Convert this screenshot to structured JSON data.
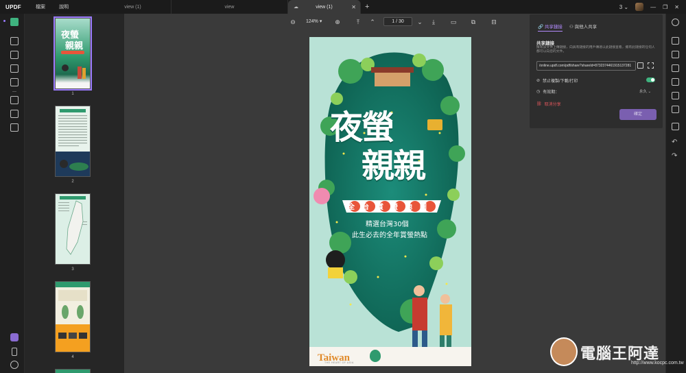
{
  "app": {
    "logo": "UPDF",
    "menu": [
      "檔案",
      "說明"
    ],
    "tabs": [
      {
        "label": "view (1)",
        "active": false
      },
      {
        "label": "view",
        "active": false
      },
      {
        "label": "view (1)",
        "active": true
      }
    ],
    "account_count": "3"
  },
  "toolbar": {
    "zoom": "124%",
    "page": "1 / 30"
  },
  "thumbnails": [
    {
      "num": "1",
      "selected": true
    },
    {
      "num": "2",
      "selected": false
    },
    {
      "num": "3",
      "selected": false
    },
    {
      "num": "4",
      "selected": false
    }
  ],
  "poster": {
    "title_line1": "夜螢",
    "title_line2": "親親",
    "ribbon": "全台賞螢地圖",
    "subtitle_line1": "精選台灣30個",
    "subtitle_line2": "此生必去的全年賞螢熱點",
    "brand": "Taiwan",
    "brand_tag": "THE HEART OF ASIA"
  },
  "share_panel": {
    "tab_share_link": "共享鏈接",
    "tab_share_with_others": "與他人共享",
    "section_title": "共享鏈接",
    "description": "擁有該文件上傳鏈接，向具有鏈接的用戶傳達以此鏈接查看，擁有此鏈接的任何人都可以向您的文件。",
    "link": "/online.updf.com/pdf/share?shareId=8732374461915137281",
    "disable_copy": "禁止複製/下載/打印",
    "validity_label": "有效期：",
    "validity_value": "永久",
    "cancel_share": "取消分享",
    "update_button": "確定"
  },
  "watermark": {
    "text": "電腦王阿達",
    "url": "http://www.kocpc.com.tw"
  },
  "colors": {
    "accent": "#9b7bff",
    "toggle": "#3fb37f",
    "danger": "#e0565b",
    "poster_green": "#0f7a6c"
  }
}
